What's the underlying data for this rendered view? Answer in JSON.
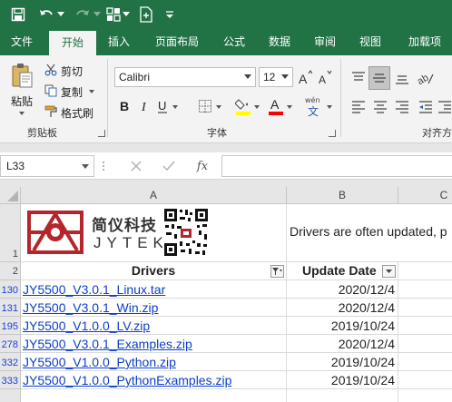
{
  "qat": {
    "icons": [
      "save-icon",
      "undo-icon",
      "undo-dropdown-icon",
      "redo-icon",
      "redo-dropdown-icon",
      "form-icon",
      "form-dropdown-icon",
      "new-sheet-icon",
      "customize-qat-icon"
    ]
  },
  "tabs": [
    {
      "label": "文件"
    },
    {
      "label": "开始",
      "active": true
    },
    {
      "label": "插入"
    },
    {
      "label": "页面布局"
    },
    {
      "label": "公式"
    },
    {
      "label": "数据"
    },
    {
      "label": "审阅"
    },
    {
      "label": "视图"
    },
    {
      "label": "加载项"
    }
  ],
  "ribbon": {
    "clipboard": {
      "paste": "粘贴",
      "cut": "剪切",
      "copy": "复制",
      "format_painter": "格式刷",
      "group_label": "剪贴板"
    },
    "font": {
      "font_name": "Calibri",
      "font_size": "12",
      "phonetic_label": "wén",
      "group_label": "字体",
      "highlight_color": "#ffff00",
      "font_color": "#ff0000"
    },
    "alignment": {
      "group_label": "对齐方"
    }
  },
  "formula_bar": {
    "name_box": "L33",
    "fx_label": "fx",
    "value": ""
  },
  "columns": [
    {
      "label": "A"
    },
    {
      "label": "B"
    },
    {
      "label": "C"
    }
  ],
  "rows": [
    {
      "num": "1"
    },
    {
      "num": "2"
    },
    {
      "num": "130"
    },
    {
      "num": "131"
    },
    {
      "num": "195"
    },
    {
      "num": "278"
    },
    {
      "num": "332"
    },
    {
      "num": "333"
    }
  ],
  "logo": {
    "cn": "简仪科技",
    "en": "JYTEK"
  },
  "row1_note": "Drivers are often updated, p",
  "headers": {
    "drivers": "Drivers",
    "update_date": "Update Date"
  },
  "drivers": [
    {
      "file": "JY5500_V3.0.1_Linux.tar",
      "date": "2020/12/4"
    },
    {
      "file": "JY5500_V3.0.1_Win.zip",
      "date": "2020/12/4"
    },
    {
      "file": "JY5500_V1.0.0_LV.zip",
      "date": "2019/10/24"
    },
    {
      "file": "JY5500_V3.0.1_Examples.zip",
      "date": "2020/12/4"
    },
    {
      "file": "JY5500_V1.0.0_Python.zip",
      "date": "2019/10/24"
    },
    {
      "file": "JY5500_V1.0.0_PythonExamples.zip",
      "date": "2019/10/24"
    }
  ],
  "colors": {
    "accent": "#217346",
    "link": "#0b3fc9",
    "logo_red": "#b5262b"
  }
}
